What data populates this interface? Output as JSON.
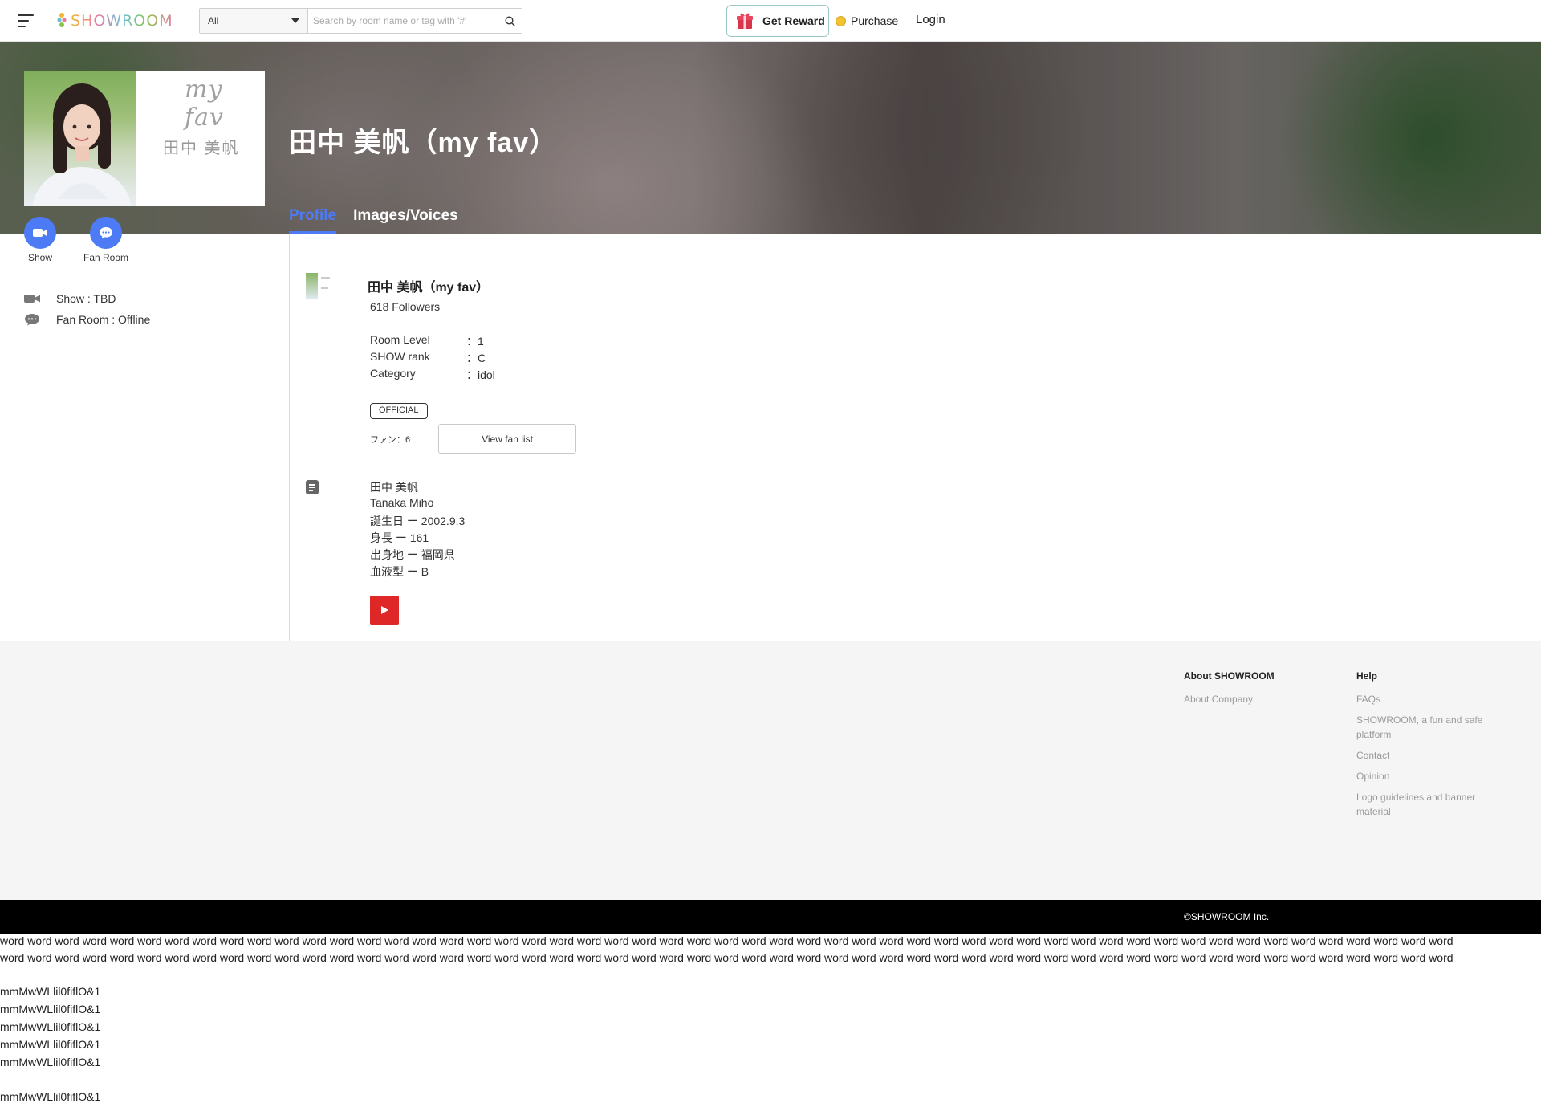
{
  "header": {
    "logo_text": "SHOWROOM",
    "search_category": "All",
    "search_placeholder": "Search by room name or tag with '#'",
    "reward_label": "Get Reward",
    "purchase_label": "Purchase",
    "login_label": "Login"
  },
  "banner": {
    "card_brand": "my fav",
    "card_name": "田中 美帆",
    "title": "田中 美帆（my fav）",
    "tabs": [
      {
        "label": "Profile",
        "active": true
      },
      {
        "label": "Images/Voices",
        "active": false
      }
    ]
  },
  "left": {
    "show_label": "Show",
    "fan_room_label": "Fan Room",
    "show_status": "Show : TBD",
    "fan_room_status": "Fan Room : Offline"
  },
  "profile": {
    "name": "田中 美帆（my fav）",
    "followers": "618 Followers",
    "stats": [
      {
        "key": "Room Level",
        "value": "：1"
      },
      {
        "key": "SHOW rank",
        "value": "：C"
      },
      {
        "key": "Category",
        "value": "：idol"
      }
    ],
    "badge": "OFFICIAL",
    "fan_count": "ファン：6",
    "fan_list_button": "View fan list",
    "bio": [
      "田中 美帆",
      "Tanaka Miho",
      "誕生日 ー 2002.9.3",
      "身長 ー 161",
      "出身地 ー 福岡県",
      "血液型 ー B"
    ]
  },
  "footer": {
    "about_heading": "About SHOWROOM",
    "about_links": [
      "About Company"
    ],
    "help_heading": "Help",
    "help_links": [
      "FAQs",
      "SHOWROOM, a fun and safe platform",
      "Contact",
      "Opinion",
      "Logo guidelines and banner material"
    ],
    "copyright": "©SHOWROOM Inc."
  },
  "test_text": {
    "word_line_1": "word word word word word word word word word word word word word word word word word word word word word word word word word word word word word word word word word word word word word word word word word word word word word word word word word word word word word",
    "word_line_2": "word word word word word word word word word word word word word word word word word word word word word word word word word word word word word word word word word word word word word word word word word word word word word word word word word word word word word",
    "glyph_lines": [
      "mmMwWLlil0fiflO&1",
      "mmMwWLlil0fiflO&1",
      "mmMwWLlil0fiflO&1",
      "mmMwWLlil0fiflO&1",
      "mmMwWLlil0fiflO&1"
    ],
    "last_glyph_line": "mmMwWLlil0fiflO&1"
  },
  "colors": {
    "accent": "#4c7bf5",
    "youtube_red": "#e02727",
    "reward_border": "#9dc8c6"
  }
}
